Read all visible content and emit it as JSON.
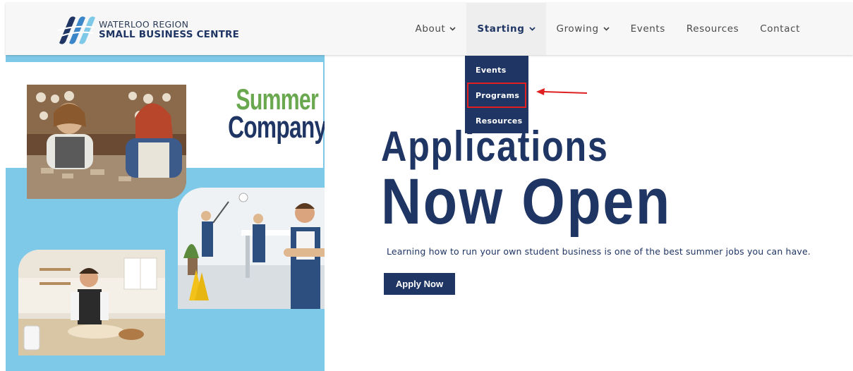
{
  "header": {
    "logo": {
      "line1": "WATERLOO REGION",
      "line2": "SMALL BUSINESS CENTRE",
      "icon": "wsbc-logo-icon"
    },
    "nav": [
      {
        "label": "About",
        "has_dropdown": true
      },
      {
        "label": "Starting",
        "has_dropdown": true,
        "active": true
      },
      {
        "label": "Growing",
        "has_dropdown": true
      },
      {
        "label": "Events",
        "has_dropdown": false
      },
      {
        "label": "Resources",
        "has_dropdown": false
      },
      {
        "label": "Contact",
        "has_dropdown": false
      }
    ],
    "chevron": "⌄"
  },
  "dropdown": {
    "items": [
      {
        "label": "Events"
      },
      {
        "label": "Programs",
        "highlighted": true
      },
      {
        "label": "Resources"
      }
    ]
  },
  "annotation": {
    "icon": "red-arrow-icon",
    "color": "#e02020"
  },
  "banner": {
    "logo_line1": "Summer",
    "logo_line2": "Company",
    "images": [
      "pottery-students-photo",
      "cleaning-team-photo",
      "baker-photo"
    ]
  },
  "hero": {
    "headline_1": "Applications",
    "headline_2": "Now Open",
    "subtext": "Learning how to run your own student business is one of the best summer jobs you can have.",
    "cta_label": "Apply Now"
  },
  "colors": {
    "brand_navy": "#1f3563",
    "brand_green": "#6aa84f",
    "banner_blue": "#7fc9e8",
    "header_bg": "#f7f7f7"
  }
}
